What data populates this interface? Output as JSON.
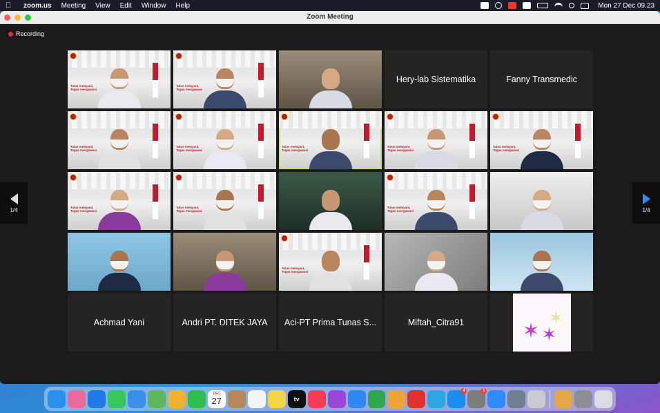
{
  "menubar": {
    "app_name": "zoom.us",
    "menus": [
      "Meeting",
      "View",
      "Edit",
      "Window",
      "Help"
    ],
    "clock": "Mon 27 Dec  09.23",
    "status_icons": [
      "zoom-icon",
      "play-icon",
      "calendar-icon",
      "keyboard-a-icon",
      "battery-icon",
      "wifi-icon",
      "search-icon",
      "control-center-icon"
    ]
  },
  "window": {
    "title": "Zoom Meeting",
    "recording_label": "Recording"
  },
  "pager": {
    "left_label": "1/4",
    "right_label": "1/4"
  },
  "participants": [
    {
      "name": "",
      "video": "office"
    },
    {
      "name": "",
      "video": "office"
    },
    {
      "name": "",
      "video": "room"
    },
    {
      "name": "Hery-lab Sistematika",
      "video": "none"
    },
    {
      "name": "Fanny Transmedic",
      "video": "none"
    },
    {
      "name": "",
      "video": "office"
    },
    {
      "name": "",
      "video": "office"
    },
    {
      "name": "",
      "video": "office",
      "active": true
    },
    {
      "name": "",
      "video": "office"
    },
    {
      "name": "",
      "video": "office"
    },
    {
      "name": "",
      "video": "office"
    },
    {
      "name": "",
      "video": "office"
    },
    {
      "name": "",
      "video": "green"
    },
    {
      "name": "",
      "video": "office"
    },
    {
      "name": "",
      "video": "bright"
    },
    {
      "name": "",
      "video": "blue"
    },
    {
      "name": "",
      "video": "room"
    },
    {
      "name": "",
      "video": "office"
    },
    {
      "name": "",
      "video": "cafe"
    },
    {
      "name": "",
      "video": "wall"
    },
    {
      "name": "Achmad Yani",
      "video": "none"
    },
    {
      "name": "Andri PT. DITEK JAYA",
      "video": "none"
    },
    {
      "name": "Aci-PT Prima Tunas S...",
      "video": "none"
    },
    {
      "name": "Miftah_Citra91",
      "video": "none"
    },
    {
      "name": "",
      "video": "avatar"
    }
  ],
  "banner": {
    "line1": "Tulus melayani,",
    "line2": "Tegas mengawasi"
  },
  "dock": {
    "apps": [
      {
        "name": "finder-icon",
        "color": "#2b8ff0"
      },
      {
        "name": "launchpad-icon",
        "color": "#e86b9c"
      },
      {
        "name": "safari-icon",
        "color": "#1f7ae8"
      },
      {
        "name": "messages-icon",
        "color": "#35c759"
      },
      {
        "name": "mail-icon",
        "color": "#3a8fe9"
      },
      {
        "name": "maps-icon",
        "color": "#5cb85c"
      },
      {
        "name": "photos-icon",
        "color": "#f2b233"
      },
      {
        "name": "facetime-icon",
        "color": "#2fbf4f"
      },
      {
        "name": "calendar-icon",
        "color": "#ffffff",
        "cal_month": "DEC",
        "cal_day": "27"
      },
      {
        "name": "contacts-icon",
        "color": "#b6875a"
      },
      {
        "name": "reminders-icon",
        "color": "#f4f4f4"
      },
      {
        "name": "notes-icon",
        "color": "#f6d44a"
      },
      {
        "name": "tv-icon",
        "color": "#111111",
        "label": "tv"
      },
      {
        "name": "music-icon",
        "color": "#fa3b55"
      },
      {
        "name": "podcasts-icon",
        "color": "#9b46d8"
      },
      {
        "name": "keynote-icon",
        "color": "#2d88f3"
      },
      {
        "name": "numbers-icon",
        "color": "#2ca84d"
      },
      {
        "name": "pages-icon",
        "color": "#f1a33b"
      },
      {
        "name": "wps-icon",
        "color": "#e0302e"
      },
      {
        "name": "telegram-icon",
        "color": "#2ea6e0"
      },
      {
        "name": "app-store-icon",
        "color": "#1a8cf2",
        "badge": "4"
      },
      {
        "name": "system-preferences-icon",
        "color": "#7d7d7d",
        "badge": "1"
      },
      {
        "name": "zoom-icon",
        "color": "#2d8cff"
      },
      {
        "name": "preview-icon",
        "color": "#6e7f8f"
      },
      {
        "name": "screenshot-icon",
        "color": "#c8ccd2"
      }
    ],
    "trailing": [
      {
        "name": "downloads-folder-icon",
        "color": "#e3a84a"
      },
      {
        "name": "recent-files-icon",
        "color": "#8a8f96"
      },
      {
        "name": "trash-icon",
        "color": "#d9dde2"
      }
    ]
  }
}
